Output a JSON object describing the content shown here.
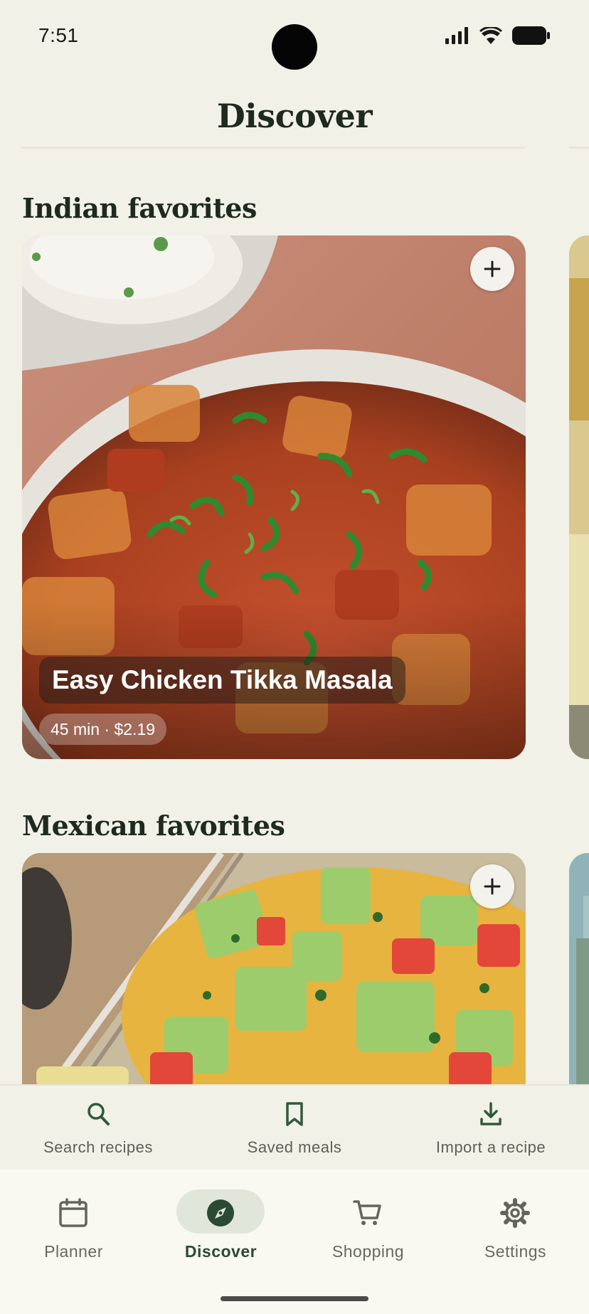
{
  "status_bar": {
    "time": "7:51"
  },
  "header": {
    "title": "Discover"
  },
  "sections": [
    {
      "title": "Indian favorites",
      "card": {
        "name": "Easy Chicken Tikka Masala",
        "meta": "45 min · $2.19",
        "add_icon": "plus-icon"
      }
    },
    {
      "title": "Mexican favorites",
      "card": {
        "add_icon": "plus-icon"
      }
    }
  ],
  "quick_actions": [
    {
      "label": "Search recipes",
      "icon": "search-icon"
    },
    {
      "label": "Saved meals",
      "icon": "bookmark-icon"
    },
    {
      "label": "Import a recipe",
      "icon": "download-icon"
    }
  ],
  "nav": {
    "active": "Discover",
    "items": [
      {
        "label": "Planner",
        "icon": "calendar-icon"
      },
      {
        "label": "Discover",
        "icon": "compass-icon"
      },
      {
        "label": "Shopping",
        "icon": "cart-icon"
      },
      {
        "label": "Settings",
        "icon": "gear-icon"
      }
    ]
  },
  "colors": {
    "background": "#f2f1e7",
    "accent": "#2a4a33",
    "active_pill": "#e1e6da"
  }
}
